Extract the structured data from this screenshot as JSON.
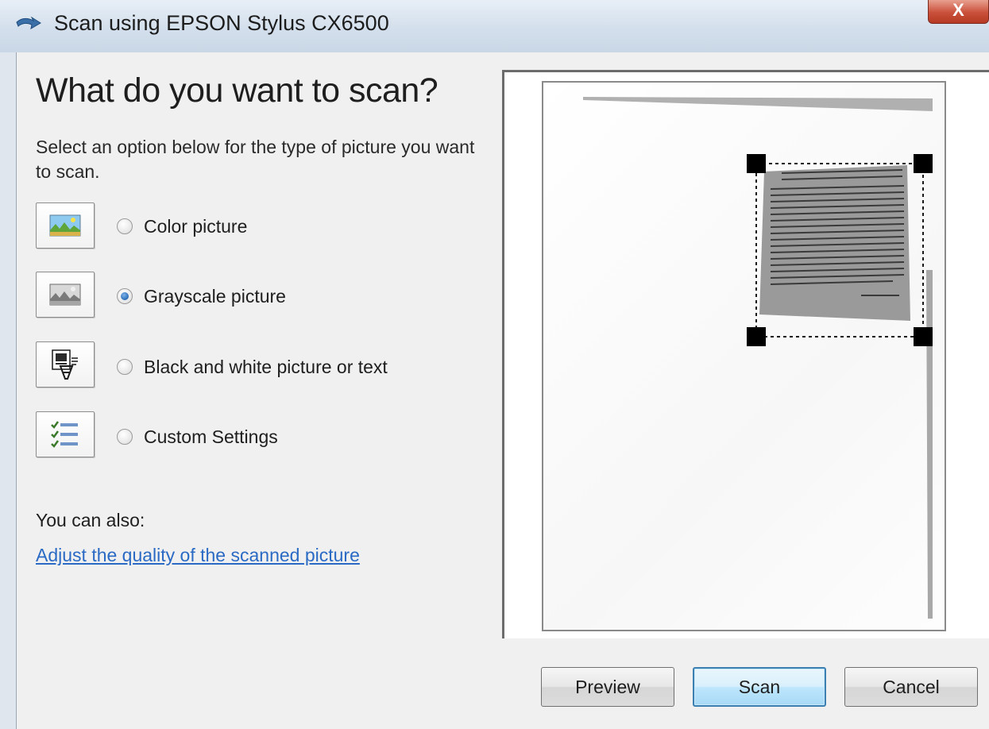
{
  "window": {
    "title": "Scan using EPSON Stylus CX6500",
    "close_label": "X"
  },
  "main": {
    "heading": "What do you want to scan?",
    "description": "Select an option below for the type of picture you want to scan.",
    "options": [
      {
        "label": "Color picture",
        "icon": "color-picture-icon",
        "selected": false
      },
      {
        "label": "Grayscale picture",
        "icon": "grayscale-picture-icon",
        "selected": true
      },
      {
        "label": "Black and white picture or text",
        "icon": "black-white-text-icon",
        "selected": false
      },
      {
        "label": "Custom Settings",
        "icon": "custom-settings-icon",
        "selected": false
      }
    ],
    "also_label": "You can also:",
    "also_link": "Adjust the quality of the scanned picture"
  },
  "buttons": {
    "preview": "Preview",
    "scan": "Scan",
    "cancel": "Cancel"
  },
  "colors": {
    "link": "#2a6ac4",
    "default_button_border": "#3c7fb1",
    "selection_handle": "#000000"
  }
}
